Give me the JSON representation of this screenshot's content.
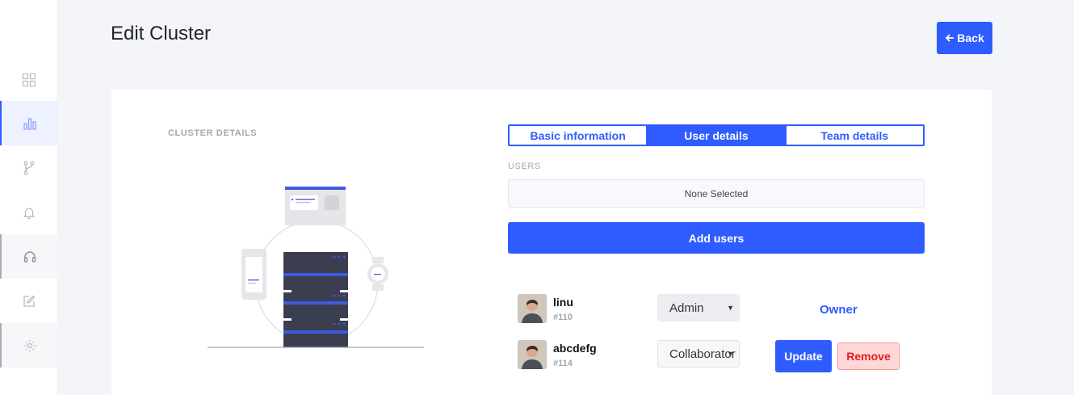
{
  "sidebar": {
    "items": [
      {
        "icon": "grid-icon"
      },
      {
        "icon": "bar-chart-icon",
        "active": true
      },
      {
        "icon": "branch-icon"
      },
      {
        "icon": "bell-icon"
      },
      {
        "icon": "headset-icon"
      },
      {
        "icon": "edit-icon"
      },
      {
        "icon": "settings-icon"
      }
    ]
  },
  "header": {
    "title": "Edit Cluster",
    "back_label": "Back",
    "back_icon": "arrow-left-icon"
  },
  "card": {
    "section_label": "CLUSTER DETAILS",
    "tabs": [
      {
        "label": "Basic information",
        "active": false
      },
      {
        "label": "User details",
        "active": true
      },
      {
        "label": "Team details",
        "active": false
      }
    ],
    "users_label": "USERS",
    "users_select_value": "None Selected",
    "add_users_label": "Add users",
    "users": [
      {
        "name": "linu",
        "id": "#110",
        "role": "Admin",
        "status": "Owner"
      },
      {
        "name": "abcdefg",
        "id": "#114",
        "role": "Collaborator",
        "update_label": "Update",
        "remove_label": "Remove"
      }
    ]
  },
  "colors": {
    "accent": "#2f5cff",
    "danger": "#e01e1e",
    "danger_bg": "#ffd7d7"
  }
}
